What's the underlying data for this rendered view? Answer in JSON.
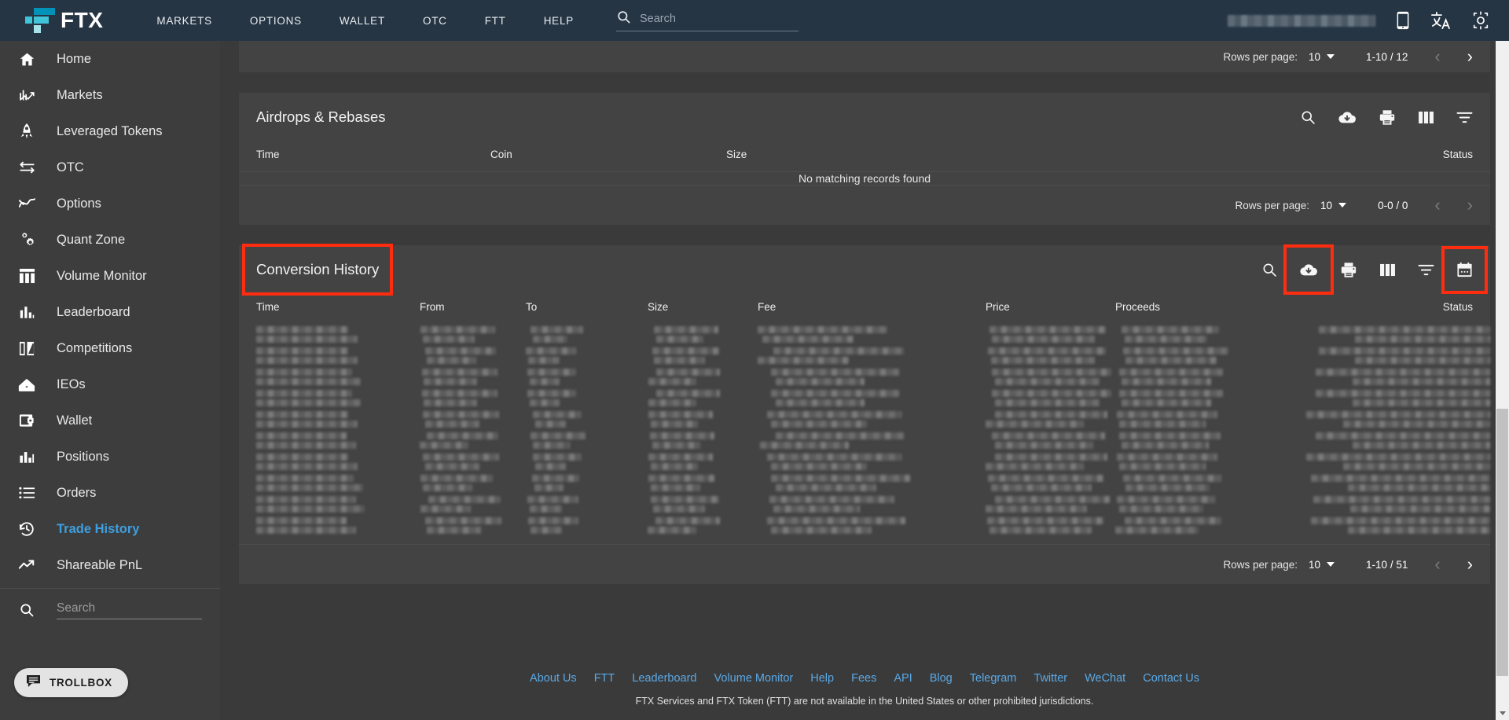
{
  "topnav": {
    "brand": "FTX",
    "links": [
      "MARKETS",
      "OPTIONS",
      "WALLET",
      "OTC",
      "FTT",
      "HELP"
    ],
    "search_placeholder": "Search",
    "search_value": "",
    "icons": [
      "mobile-icon",
      "translate-icon",
      "theme-icon"
    ],
    "user_redacted": ""
  },
  "sidebar": {
    "items": [
      {
        "label": "Home",
        "icon": "home-icon",
        "active": false
      },
      {
        "label": "Markets",
        "icon": "markets-icon",
        "active": false
      },
      {
        "label": "Leveraged Tokens",
        "icon": "rocket-icon",
        "active": false
      },
      {
        "label": "OTC",
        "icon": "exchange-arrows-icon",
        "active": false
      },
      {
        "label": "Options",
        "icon": "wave-chart-icon",
        "active": false
      },
      {
        "label": "Quant Zone",
        "icon": "gears-icon",
        "active": false
      },
      {
        "label": "Volume Monitor",
        "icon": "columns-icon",
        "active": false
      },
      {
        "label": "Leaderboard",
        "icon": "bar-chart-icon",
        "active": false
      },
      {
        "label": "Competitions",
        "icon": "flag-icon",
        "active": false
      },
      {
        "label": "IEOs",
        "icon": "inbox-icon",
        "active": false
      },
      {
        "label": "Wallet",
        "icon": "wallet-icon",
        "active": false
      },
      {
        "label": "Positions",
        "icon": "bars-icon",
        "active": false
      },
      {
        "label": "Orders",
        "icon": "list-icon",
        "active": false
      },
      {
        "label": "Trade History",
        "icon": "history-clock-icon",
        "active": true
      },
      {
        "label": "Shareable PnL",
        "icon": "trend-up-icon",
        "active": false
      }
    ],
    "search_placeholder": "Search",
    "search_value": "",
    "trollbox_label": "TROLLBOX",
    "active_color": "#3e9fe0"
  },
  "top_pager": {
    "rows_label": "Rows per page:",
    "rows_value": "10",
    "range": "1-10 / 12",
    "prev_enabled": false,
    "next_enabled": true
  },
  "airdrops": {
    "title": "Airdrops & Rebases",
    "tools": [
      "search-icon",
      "cloud-download-icon",
      "print-icon",
      "columns-icon",
      "filter-icon"
    ],
    "columns": [
      "Time",
      "Coin",
      "Size",
      "Status"
    ],
    "empty_message": "No matching records found",
    "pager": {
      "rows_label": "Rows per page:",
      "rows_value": "10",
      "range": "0-0 / 0",
      "prev_enabled": false,
      "next_enabled": false
    }
  },
  "conversion": {
    "title": "Conversion History",
    "tools": [
      "search-icon",
      "cloud-download-icon",
      "print-icon",
      "columns-icon",
      "filter-icon",
      "calendar-icon"
    ],
    "columns": [
      "Time",
      "From",
      "To",
      "Size",
      "Fee",
      "Price",
      "Proceeds",
      "Status"
    ],
    "rows_redacted": 10,
    "pager": {
      "rows_label": "Rows per page:",
      "rows_value": "10",
      "range": "1-10 / 51",
      "prev_enabled": false,
      "next_enabled": true
    }
  },
  "annotations": {
    "color": "#ff2d10",
    "boxes": [
      "conversion-history-title",
      "cloud-download-icon",
      "calendar-icon"
    ]
  },
  "footer": {
    "links": [
      "About Us",
      "FTT",
      "Leaderboard",
      "Volume Monitor",
      "Help",
      "Fees",
      "API",
      "Blog",
      "Telegram",
      "Twitter",
      "WeChat",
      "Contact Us"
    ],
    "note": "FTX Services and FTX Token (FTT) are not available in the United States or other prohibited jurisdictions.",
    "link_color": "#5aa9e6"
  }
}
